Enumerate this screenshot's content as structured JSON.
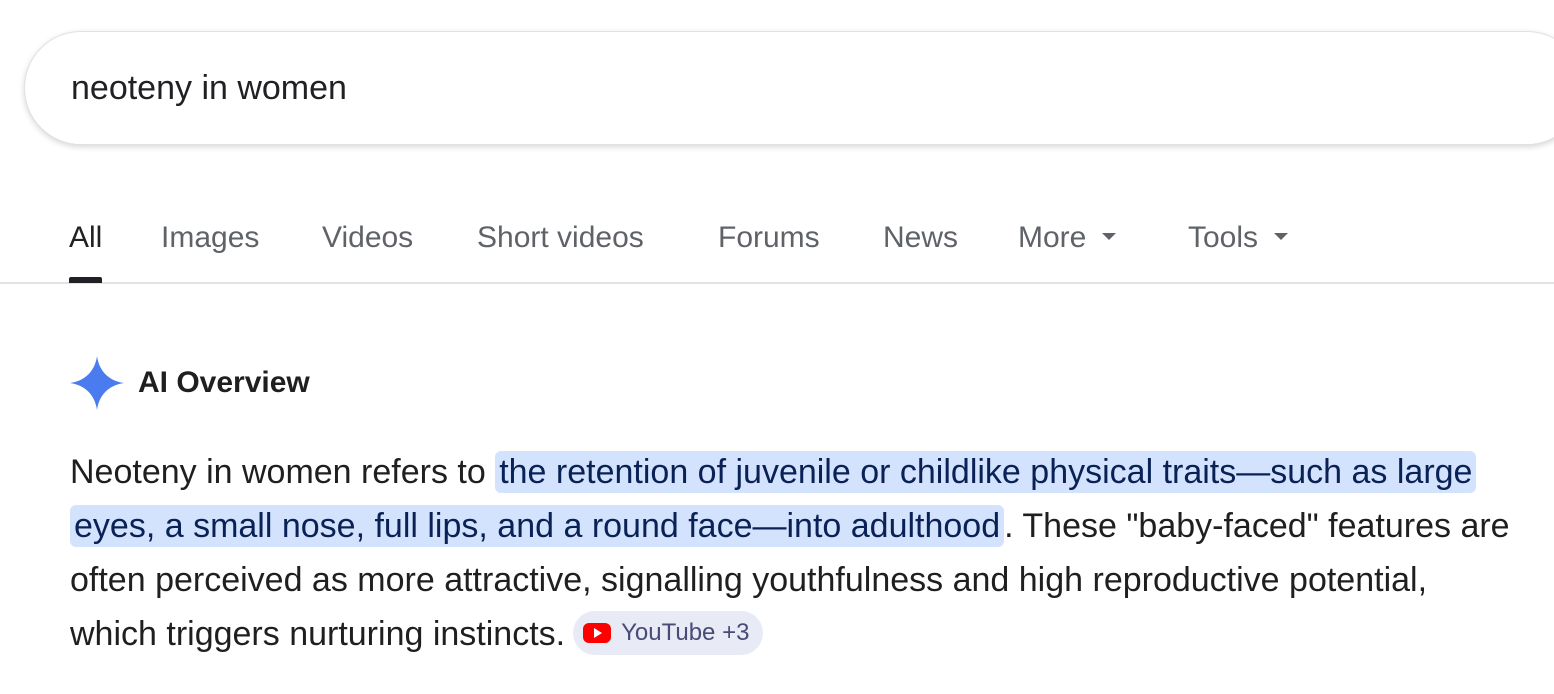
{
  "search": {
    "query": "neoteny in women"
  },
  "tabs": [
    {
      "label": "All",
      "active": true
    },
    {
      "label": "Images"
    },
    {
      "label": "Videos"
    },
    {
      "label": "Short videos"
    },
    {
      "label": "Forums"
    },
    {
      "label": "News"
    },
    {
      "label": "More",
      "dropdown": true
    },
    {
      "label": "Tools",
      "dropdown": true
    }
  ],
  "ai_overview": {
    "title": "AI Overview",
    "icon": "sparkle-icon",
    "body_before": "Neoteny in women refers to ",
    "highlight": "the retention of juvenile or childlike physical traits—such as large eyes, a small nose, full lips, and a round face—into adulthood",
    "body_after": ". These \"baby-faced\" features are often perceived as more attractive, signalling youthfulness and high reproductive potential, which triggers nurturing instincts.",
    "source_chip": {
      "icon": "youtube-icon",
      "label": "YouTube +3"
    }
  },
  "colors": {
    "highlight_bg": "#d3e3fd",
    "sparkle": "#4a7cf0",
    "youtube_red": "#ff0000"
  }
}
